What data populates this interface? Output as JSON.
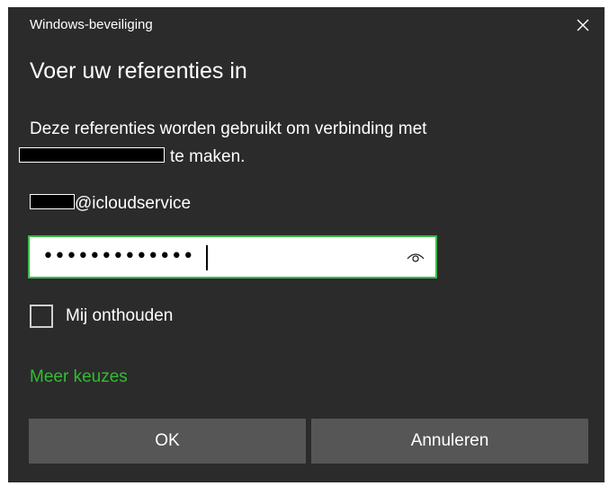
{
  "window": {
    "title": "Windows-beveiliging",
    "close_icon": "close-icon"
  },
  "dialog": {
    "heading": "Voer uw referenties in",
    "description_line1": "Deze referenties worden gebruikt om verbinding met",
    "description_line2": "te maken."
  },
  "account": {
    "username_suffix": "@icloudservice"
  },
  "password": {
    "masked_value": "•••••••••••••",
    "reveal_icon": "eye-icon"
  },
  "remember": {
    "label": "Mij onthouden",
    "checked": false
  },
  "links": {
    "more_choices": "Meer keuzes"
  },
  "buttons": {
    "ok": "OK",
    "cancel": "Annuleren"
  },
  "colors": {
    "dialog_bg": "#2b2b2b",
    "accent_green": "#2fbf2f",
    "focus_border": "#3fb84a",
    "button_bg": "#565656"
  }
}
